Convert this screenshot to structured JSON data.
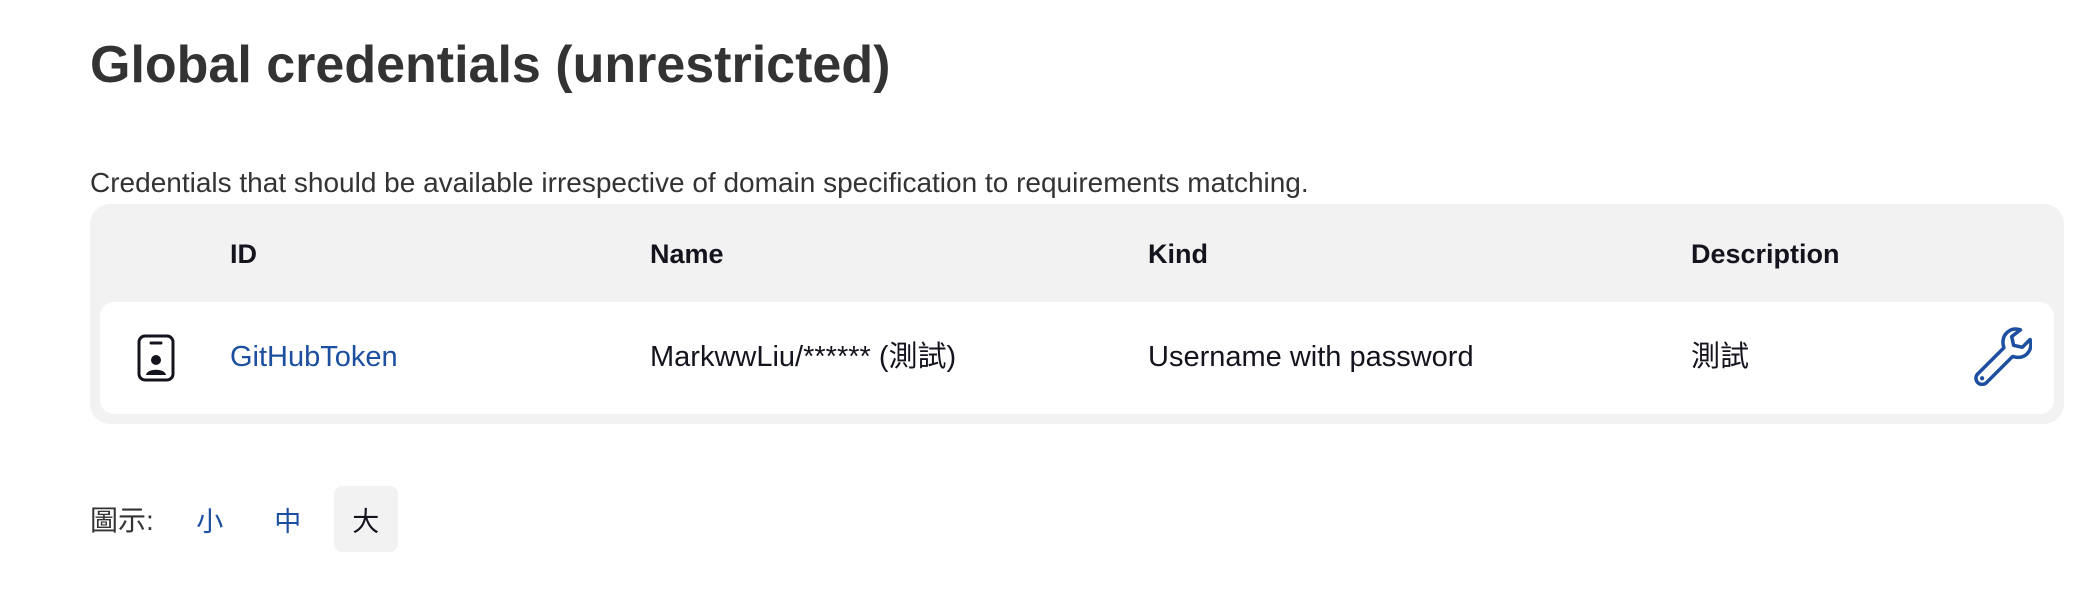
{
  "page": {
    "title": "Global credentials (unrestricted)",
    "description": "Credentials that should be available irrespective of domain specification to requirements matching."
  },
  "table": {
    "columns": [
      "ID",
      "Name",
      "Kind",
      "Description"
    ],
    "rows": [
      {
        "icon": "credential-card-icon",
        "id": "GitHubToken",
        "name": "MarkwwLiu/****** (測試)",
        "kind": "Username with password",
        "description": "測試",
        "action_icon": "wrench-icon"
      }
    ]
  },
  "icon_size": {
    "label": "圖示:",
    "options": [
      "小",
      "中",
      "大"
    ],
    "selected": "大"
  },
  "colors": {
    "link": "#1c4fa0",
    "table_bg": "#f2f2f2",
    "text": "#14141f"
  }
}
